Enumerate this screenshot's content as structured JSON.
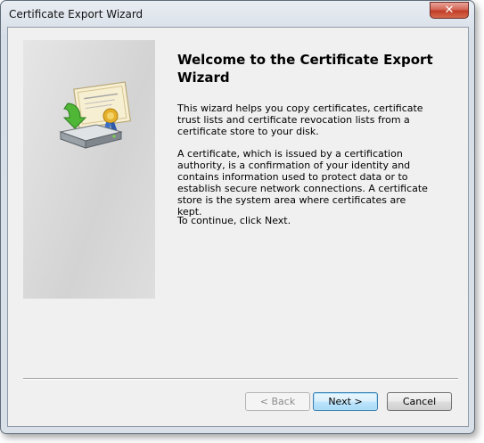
{
  "window": {
    "title": "Certificate Export Wizard",
    "close_glyph": "✕"
  },
  "main": {
    "heading": "Welcome to the Certificate Export Wizard",
    "paragraphs": [
      "This wizard helps you copy certificates, certificate trust lists and certificate revocation lists from a certificate store to your disk.",
      "A certificate, which is issued by a certification authority, is a confirmation of your identity and contains information used to protect data or to establish secure network connections. A certificate store is the system area where certificates are kept.",
      "To continue, click Next."
    ]
  },
  "buttons": {
    "back": "< Back",
    "next": "Next >",
    "cancel": "Cancel"
  },
  "icons": {
    "wizard_art": "certificate-export-icon",
    "close": "close-icon"
  }
}
